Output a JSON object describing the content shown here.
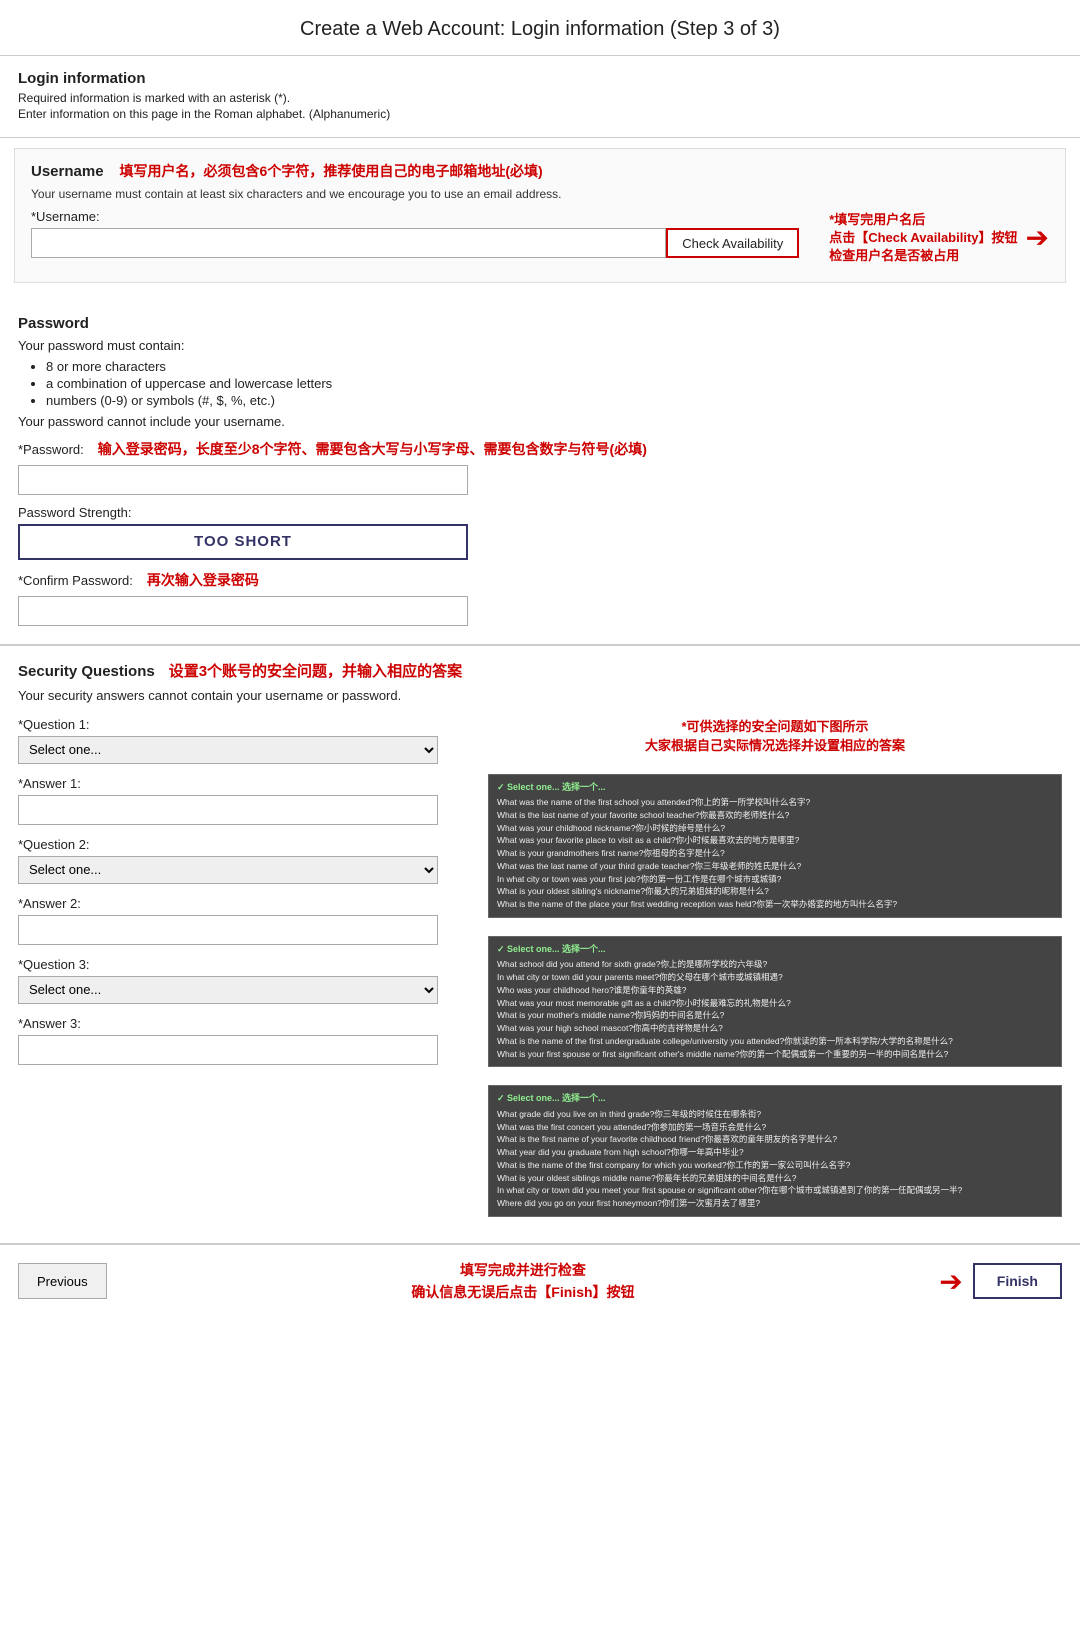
{
  "page": {
    "title": "Create a Web Account: Login information (Step 3 of 3)"
  },
  "login_info": {
    "section_title": "Login information",
    "required_note": "Required information is marked with an asterisk (*).",
    "alpha_note": "Enter information on this page in the Roman alphabet. (Alphanumeric)",
    "username_block": {
      "label": "Username",
      "annotation": "填写用户名，必须包含6个字符，推荐使用自己的电子邮箱地址(必填)",
      "desc": "Your username must contain at least six characters and we encourage you to use an email address.",
      "field_label": "*Username:",
      "check_btn": "Check Availability",
      "arrow_text_line1": "*填写完用户名后",
      "arrow_text_line2": "点击【Check Availability】按钮",
      "arrow_text_line3": "检查用户名是否被占用"
    }
  },
  "password": {
    "section_title": "Password",
    "req_intro": "Your password must contain:",
    "req1": "8 or more characters",
    "req2": "a combination of uppercase and lowercase letters",
    "req3": "numbers (0-9) or symbols (#, $, %, etc.)",
    "cannot_note": "Your password cannot include your username.",
    "field_label": "*Password:",
    "annotation": "输入登录密码，长度至少8个字符、需要包含大写与小写字母、需要包含数字与符号(必填)",
    "strength_label": "Password Strength:",
    "too_short": "TOO SHORT",
    "confirm_label": "*Confirm Password:",
    "confirm_annotation": "再次输入登录密码"
  },
  "security": {
    "section_title": "Security Questions",
    "annotation": "设置3个账号的安全问题，并输入相应的答案",
    "cannot_note": "Your security answers cannot contain your username or password.",
    "right_annotation_line1": "*可供选择的安全问题如下图所示",
    "right_annotation_line2": "大家根据自己实际情况选择并设置相应的答案",
    "q1_label": "*Question 1:",
    "q1_placeholder": "Select one...",
    "q1_annotation": "选择一个...",
    "a1_label": "*Answer 1:",
    "q2_label": "*Question 2:",
    "q2_placeholder": "Select one...",
    "q2_annotation": "选择一个...",
    "a2_label": "*Answer 2:",
    "q3_label": "*Question 3:",
    "q3_placeholder": "Select one...",
    "q3_annotation": "选择一个...",
    "a3_label": "*Answer 3:",
    "options1": [
      "What was the name of the first school you attended?你上的第一所学校叫什么名字?",
      "What is the last name of your favorite school teacher?你最喜欢的老师姓什么?",
      "What was your childhood nickname?你小时候的绰号是什么?",
      "What was your favorite place to visit as a child?你小时候最喜欢去的地方是哪里?",
      "What is your grandmothers first name?你祖母的名字是什么?",
      "What was the last name of your third grade teacher?你三年级老师的姓氏是什么?",
      "In what city or town was your first job?你的第一份工作是在哪个城市或城镇?",
      "What is your oldest sibling's nickname?你最大的兄弟姐妹的昵称是什么?",
      "What is the name of the place your first wedding reception was held?你第一次举办婚宴的地方叫什么名字?"
    ],
    "options2": [
      "What school did you attend for sixth grade?你上的是哪所学校的六年级?",
      "In what city or town did your parents meet?你的父母在哪个城市或城镇相遇?",
      "Who was your childhood hero?谁是你童年的英雄?",
      "What was your most memorable gift as a child?你小时候最难忘的礼物是什么?",
      "What is your mother's middle name?你妈妈的中间名是什么?",
      "What was your high school mascot?你高中的吉祥物是什么?",
      "What is the name of the first undergraduate college/university you attended?你就读的第一所本科学院/大学的名称是什么?",
      "What is your first spouse or first significant other's middle name?你的第一个配偶或第一个重要的另一半的中间名是什么?"
    ],
    "options3": [
      "What grade did you live on in third grade?你三年级的时候住在哪条街?",
      "What was the first concert you attended?你参加的第一场音乐会是什么?",
      "What is the first name of your favorite childhood friend?你最喜欢的童年朋友的名字是什么?",
      "What year did you graduate from high school?你哪一年高中毕业?",
      "What is the name of the first company for which you worked?你工作的第一家公司叫什么名字?",
      "What is your oldest siblings middle name?你最年长的兄弟姐妹的中间名是什么?",
      "In what city or town did you meet your first spouse or significant other?你在哪个城市或城镇遇到了你的第一任配偶或另一半?",
      "Where did you go on your first honeymoon?你们第一次蜜月去了哪里?"
    ]
  },
  "footer": {
    "annotation_line1": "填写完成并进行检查",
    "annotation_line2": "确认信息无误后点击【Finish】按钮",
    "prev_label": "Previous",
    "finish_label": "Finish"
  }
}
